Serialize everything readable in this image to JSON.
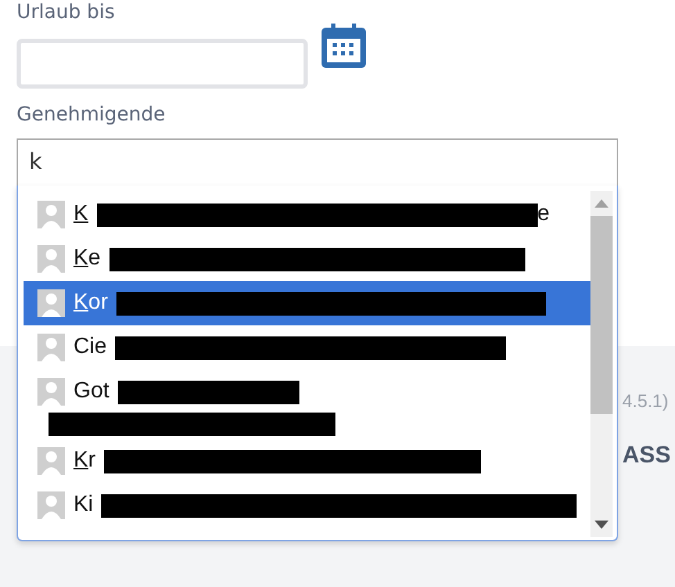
{
  "date_field": {
    "label": "Urlaub bis"
  },
  "approver_field": {
    "label": "Genehmigende",
    "value": "k"
  },
  "suggestions": [
    {
      "match": "K",
      "tail": "e",
      "selected": false,
      "second_line": false
    },
    {
      "match": "K",
      "rest": "e",
      "selected": false,
      "second_line": false
    },
    {
      "match": "K",
      "rest": "or",
      "selected": true,
      "second_line": false
    },
    {
      "rest": "Cie",
      "selected": false,
      "second_line": false
    },
    {
      "rest": "Got",
      "selected": false,
      "second_line": true
    },
    {
      "match": "K",
      "rest": "r",
      "selected": false,
      "second_line": false
    },
    {
      "rest": "Ki",
      "selected": false,
      "second_line": false
    }
  ],
  "footer": {
    "version": "4.5.1)",
    "brand": "ASS"
  }
}
